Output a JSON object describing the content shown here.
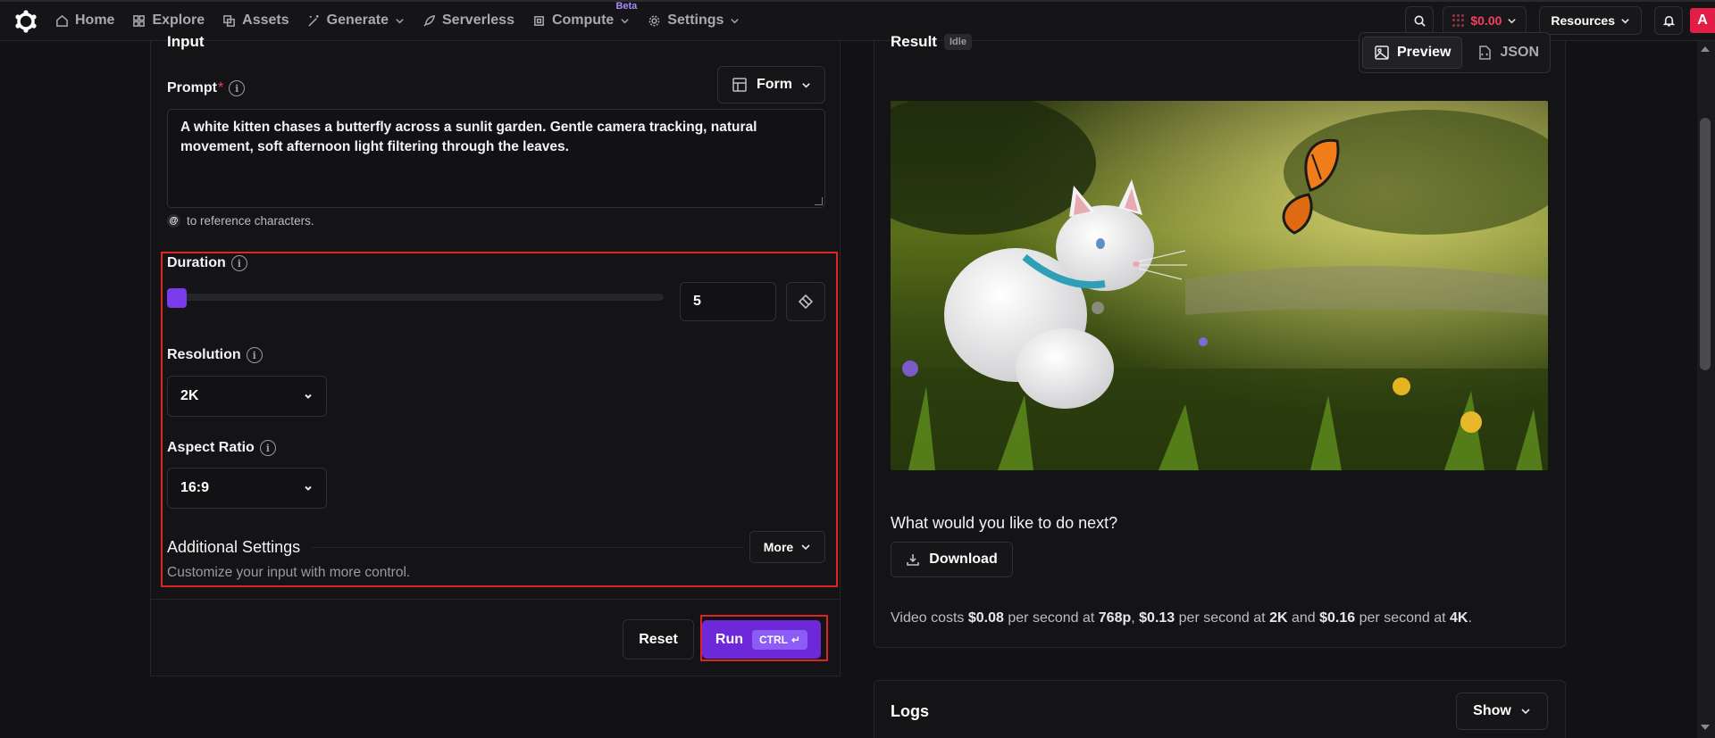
{
  "nav": {
    "items": [
      {
        "label": "Home",
        "icon": "home-icon"
      },
      {
        "label": "Explore",
        "icon": "grid-icon"
      },
      {
        "label": "Assets",
        "icon": "assets-icon"
      },
      {
        "label": "Generate",
        "icon": "wand-icon",
        "dropdown": true
      },
      {
        "label": "Serverless",
        "icon": "rocket-icon"
      },
      {
        "label": "Compute",
        "icon": "chip-icon",
        "dropdown": true,
        "badge": "Beta"
      },
      {
        "label": "Settings",
        "icon": "gear-icon",
        "dropdown": true
      }
    ],
    "balance": "$0.00",
    "resources_label": "Resources",
    "avatar_letter": "A"
  },
  "input": {
    "title": "Input",
    "form_toggle": "Form",
    "prompt": {
      "label": "Prompt",
      "required_mark": "*",
      "value": "A white kitten chases a butterfly across a sunlit garden. Gentle camera tracking, natural movement, soft afternoon light filtering through the leaves."
    },
    "reference_hint": "to reference characters.",
    "duration": {
      "label": "Duration",
      "value": "5",
      "slider_fraction": 0
    },
    "resolution": {
      "label": "Resolution",
      "value": "2K"
    },
    "aspect_ratio": {
      "label": "Aspect Ratio",
      "value": "16:9"
    },
    "additional": {
      "title": "Additional Settings",
      "subtitle": "Customize your input with more control.",
      "more_label": "More"
    },
    "reset_label": "Reset",
    "run_label": "Run",
    "run_shortcut": "CTRL"
  },
  "result": {
    "title": "Result",
    "status": "Idle",
    "tabs": [
      {
        "label": "Preview",
        "active": true
      },
      {
        "label": "JSON",
        "active": false
      }
    ],
    "next_question": "What would you like to do next?",
    "download_label": "Download",
    "cost": {
      "prefix": "Video costs",
      "p1": "$0.08",
      "t1": "per second at",
      "r1": "768p",
      "p2": "$0.13",
      "t2": "per second at",
      "r2": "2K",
      "and": "and",
      "p3": "$0.16",
      "t3": "per second at",
      "r3": "4K"
    }
  },
  "logs": {
    "title": "Logs",
    "show_label": "Show"
  },
  "colors": {
    "accent": "#6d28d9",
    "highlight": "#dc2626",
    "balance": "#f43f5e"
  }
}
